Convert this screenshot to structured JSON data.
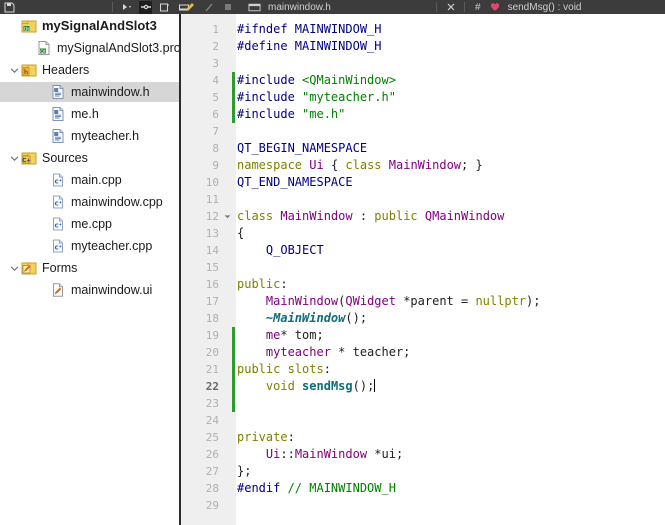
{
  "toolbar": {
    "icons_left": [
      "save-all-icon",
      "run-debug-dropdown-icon",
      "debug-step-icon",
      "step-over-icon",
      "step-out-icon"
    ],
    "icons_right": [
      "pencil-icon",
      "slash-icon",
      "stop-icon",
      "split-editor-icon"
    ],
    "file_tab_label": "mainwindow.h",
    "symbol_nav_label": "sendMsg() : void",
    "close_icon": "close-icon",
    "hash_label": "#",
    "heart_icon": "heart-icon"
  },
  "sidebar": {
    "tree": [
      {
        "label": "mySignalAndSlot3",
        "icon": "qt-project-icon",
        "indent": 0,
        "arrow": "none",
        "bold": true,
        "selected": false
      },
      {
        "label": "mySignalAndSlot3.pro",
        "icon": "qt-pro-file-icon",
        "indent": 1,
        "arrow": "none",
        "bold": false,
        "selected": false
      },
      {
        "label": "Headers",
        "icon": "headers-folder-icon",
        "indent": 0,
        "arrow": "down",
        "bold": false,
        "selected": false
      },
      {
        "label": "mainwindow.h",
        "icon": "header-file-icon",
        "indent": 2,
        "arrow": "none",
        "bold": false,
        "selected": true
      },
      {
        "label": "me.h",
        "icon": "header-file-icon",
        "indent": 2,
        "arrow": "none",
        "bold": false,
        "selected": false
      },
      {
        "label": "myteacher.h",
        "icon": "header-file-icon",
        "indent": 2,
        "arrow": "none",
        "bold": false,
        "selected": false
      },
      {
        "label": "Sources",
        "icon": "sources-folder-icon",
        "indent": 0,
        "arrow": "down",
        "bold": false,
        "selected": false
      },
      {
        "label": "main.cpp",
        "icon": "cpp-file-icon",
        "indent": 2,
        "arrow": "none",
        "bold": false,
        "selected": false
      },
      {
        "label": "mainwindow.cpp",
        "icon": "cpp-file-icon",
        "indent": 2,
        "arrow": "none",
        "bold": false,
        "selected": false
      },
      {
        "label": "me.cpp",
        "icon": "cpp-file-icon",
        "indent": 2,
        "arrow": "none",
        "bold": false,
        "selected": false
      },
      {
        "label": "myteacher.cpp",
        "icon": "cpp-file-icon",
        "indent": 2,
        "arrow": "none",
        "bold": false,
        "selected": false
      },
      {
        "label": "Forms",
        "icon": "forms-folder-icon",
        "indent": 0,
        "arrow": "down",
        "bold": false,
        "selected": false
      },
      {
        "label": "mainwindow.ui",
        "icon": "ui-file-icon",
        "indent": 2,
        "arrow": "none",
        "bold": false,
        "selected": false
      }
    ]
  },
  "editor": {
    "filename": "mainwindow.h",
    "language": "C++",
    "current_line": 22,
    "total_lines": 29,
    "fold_marker_line": 12,
    "change_bars": [
      {
        "from": 4,
        "to": 6,
        "color": "#2e9b2e"
      },
      {
        "from": 19,
        "to": 23,
        "color": "#2e9b2e"
      }
    ],
    "line_numbers": [
      1,
      2,
      3,
      4,
      5,
      6,
      7,
      8,
      9,
      10,
      11,
      12,
      13,
      14,
      15,
      16,
      17,
      18,
      19,
      20,
      21,
      22,
      23,
      24,
      25,
      26,
      27,
      28,
      29
    ],
    "lines": [
      {
        "n": 1,
        "tokens": [
          {
            "t": "#ifndef ",
            "c": "pre"
          },
          {
            "t": "MAINWINDOW_H",
            "c": "macro"
          }
        ]
      },
      {
        "n": 2,
        "tokens": [
          {
            "t": "#define ",
            "c": "pre"
          },
          {
            "t": "MAINWINDOW_H",
            "c": "macro"
          }
        ]
      },
      {
        "n": 3,
        "tokens": []
      },
      {
        "n": 4,
        "tokens": [
          {
            "t": "#include ",
            "c": "pre"
          },
          {
            "t": "<QMainWindow>",
            "c": "str"
          }
        ]
      },
      {
        "n": 5,
        "tokens": [
          {
            "t": "#include ",
            "c": "pre"
          },
          {
            "t": "\"myteacher.h\"",
            "c": "str"
          }
        ]
      },
      {
        "n": 6,
        "tokens": [
          {
            "t": "#include ",
            "c": "pre"
          },
          {
            "t": "\"me.h\"",
            "c": "str"
          }
        ]
      },
      {
        "n": 7,
        "tokens": []
      },
      {
        "n": 8,
        "tokens": [
          {
            "t": "QT_BEGIN_NAMESPACE",
            "c": "macro"
          }
        ]
      },
      {
        "n": 9,
        "tokens": [
          {
            "t": "namespace",
            "c": "kw"
          },
          {
            "t": " ",
            "c": "plain"
          },
          {
            "t": "Ui",
            "c": "type"
          },
          {
            "t": " { ",
            "c": "plain"
          },
          {
            "t": "class",
            "c": "kw"
          },
          {
            "t": " ",
            "c": "plain"
          },
          {
            "t": "MainWindow",
            "c": "type"
          },
          {
            "t": "; }",
            "c": "plain"
          }
        ]
      },
      {
        "n": 10,
        "tokens": [
          {
            "t": "QT_END_NAMESPACE",
            "c": "macro"
          }
        ]
      },
      {
        "n": 11,
        "tokens": []
      },
      {
        "n": 12,
        "tokens": [
          {
            "t": "class",
            "c": "kw"
          },
          {
            "t": " ",
            "c": "plain"
          },
          {
            "t": "MainWindow",
            "c": "type"
          },
          {
            "t": " : ",
            "c": "plain"
          },
          {
            "t": "public",
            "c": "kw"
          },
          {
            "t": " ",
            "c": "plain"
          },
          {
            "t": "QMainWindow",
            "c": "type"
          }
        ]
      },
      {
        "n": 13,
        "tokens": [
          {
            "t": "{",
            "c": "plain"
          }
        ]
      },
      {
        "n": 14,
        "tokens": [
          {
            "t": "    ",
            "c": "plain"
          },
          {
            "t": "Q_OBJECT",
            "c": "macro"
          }
        ]
      },
      {
        "n": 15,
        "tokens": []
      },
      {
        "n": 16,
        "tokens": [
          {
            "t": "public",
            "c": "kw"
          },
          {
            "t": ":",
            "c": "plain"
          }
        ]
      },
      {
        "n": 17,
        "tokens": [
          {
            "t": "    ",
            "c": "plain"
          },
          {
            "t": "MainWindow",
            "c": "type"
          },
          {
            "t": "(",
            "c": "plain"
          },
          {
            "t": "QWidget",
            "c": "type"
          },
          {
            "t": " *parent = ",
            "c": "plain"
          },
          {
            "t": "nullptr",
            "c": "kw"
          },
          {
            "t": ");",
            "c": "plain"
          }
        ]
      },
      {
        "n": 18,
        "tokens": [
          {
            "t": "    ",
            "c": "plain"
          },
          {
            "t": "~MainWindow",
            "c": "virt"
          },
          {
            "t": "();",
            "c": "plain"
          }
        ]
      },
      {
        "n": 19,
        "tokens": [
          {
            "t": "    ",
            "c": "plain"
          },
          {
            "t": "me",
            "c": "type"
          },
          {
            "t": "* tom;",
            "c": "plain"
          }
        ]
      },
      {
        "n": 20,
        "tokens": [
          {
            "t": "    ",
            "c": "plain"
          },
          {
            "t": "myteacher",
            "c": "type"
          },
          {
            "t": " * teacher;",
            "c": "plain"
          }
        ]
      },
      {
        "n": 21,
        "tokens": [
          {
            "t": "public slots",
            "c": "kw"
          },
          {
            "t": ":",
            "c": "plain"
          }
        ]
      },
      {
        "n": 22,
        "tokens": [
          {
            "t": "    ",
            "c": "plain"
          },
          {
            "t": "void",
            "c": "kw"
          },
          {
            "t": " ",
            "c": "plain"
          },
          {
            "t": "sendMsg",
            "c": "fn"
          },
          {
            "t": "();",
            "c": "plain"
          }
        ],
        "caret_after": true
      },
      {
        "n": 23,
        "tokens": []
      },
      {
        "n": 24,
        "tokens": []
      },
      {
        "n": 25,
        "tokens": [
          {
            "t": "private",
            "c": "kw"
          },
          {
            "t": ":",
            "c": "plain"
          }
        ]
      },
      {
        "n": 26,
        "tokens": [
          {
            "t": "    ",
            "c": "plain"
          },
          {
            "t": "Ui",
            "c": "type"
          },
          {
            "t": "::",
            "c": "plain"
          },
          {
            "t": "MainWindow",
            "c": "type"
          },
          {
            "t": " *ui;",
            "c": "plain"
          }
        ]
      },
      {
        "n": 27,
        "tokens": [
          {
            "t": "};",
            "c": "plain"
          }
        ]
      },
      {
        "n": 28,
        "tokens": [
          {
            "t": "#endif ",
            "c": "pre"
          },
          {
            "t": "// MAINWINDOW_H",
            "c": "cmt"
          }
        ]
      },
      {
        "n": 29,
        "tokens": []
      }
    ]
  },
  "colors": {
    "toolbar_bg": "#3c3c3c",
    "gutter_bg": "#efefef",
    "editor_bg": "#ffffff",
    "selection_bg": "#d6d6d6",
    "change_bar": "#2e9b2e",
    "divider": "#2b2b2b",
    "preprocessor": "#000080",
    "string": "#008000",
    "keyword": "#808000",
    "type": "#800080",
    "comment": "#008000",
    "function": "#0d6d7a"
  }
}
